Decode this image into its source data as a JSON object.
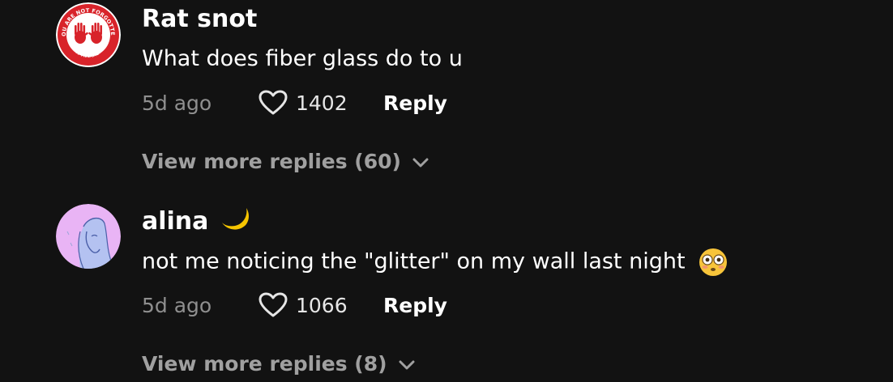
{
  "comments": [
    {
      "username": "Rat snot",
      "avatar_icon": "red-handprint-badge-icon",
      "avatar_badge_text_top": "YOU ARE NOT FORGOTTEN",
      "avatar_badge_text_bottom": "MMIW AWARENESS",
      "text": "What does fiber glass do to u",
      "time": "5d ago",
      "likes": "1402",
      "reply_label": "Reply",
      "more_replies": "View more replies (60)"
    },
    {
      "username": "alina",
      "username_emoji": "crescent-moon-icon",
      "avatar_icon": "drawn-portrait-avatar",
      "text": "not me noticing the \"glitter\" on my wall last night",
      "text_emoji": "flushed-face-icon",
      "time": "5d ago",
      "likes": "1066",
      "reply_label": "Reply",
      "more_replies": "View more replies (8)"
    }
  ],
  "colors": {
    "background": "#121212",
    "text_primary": "#ffffff",
    "text_secondary": "#8f8f8f",
    "view_more": "#a0a0a0",
    "moon": "#f5c400",
    "avatar1_ring": "#d8232a",
    "avatar2_bg": "#e9b4f5"
  }
}
